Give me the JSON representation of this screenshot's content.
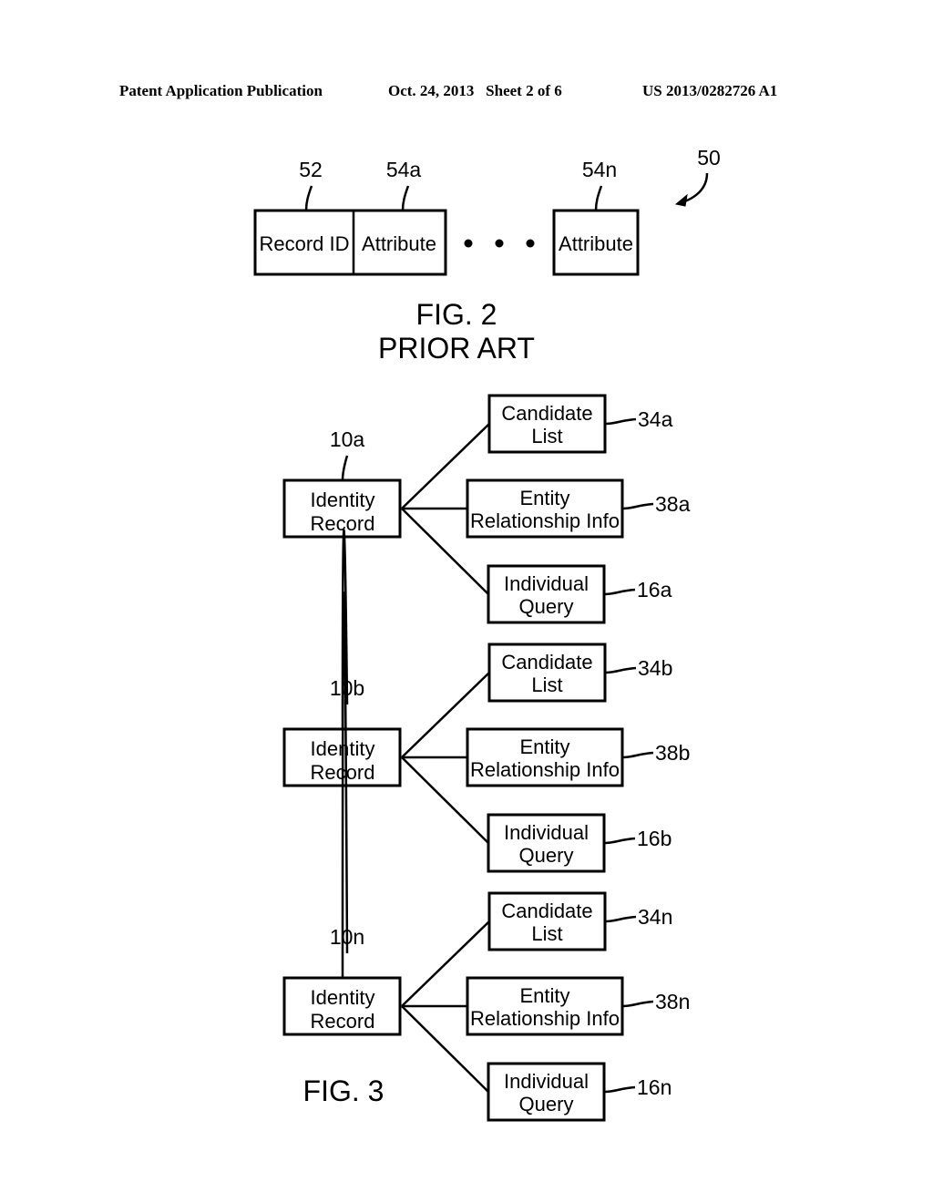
{
  "header": {
    "left": "Patent Application Publication",
    "middle": "Oct. 24, 2013   Sheet 2 of 6",
    "right": "US 2013/0282726 A1"
  },
  "fig2": {
    "ref": "50",
    "cells": [
      {
        "ref": "52",
        "label": "Record ID"
      },
      {
        "ref": "54a",
        "label": "Attribute"
      },
      {
        "ref": "54n",
        "label": "Attribute"
      }
    ],
    "caption_line1": "FIG. 2",
    "caption_line2": "PRIOR ART"
  },
  "fig3": {
    "caption": "FIG. 3",
    "groups": [
      {
        "root_ref": "10a",
        "root": [
          "Identity",
          "Record"
        ],
        "children": [
          {
            "ref": "34a",
            "lines": [
              "Candidate",
              "List"
            ]
          },
          {
            "ref": "38a",
            "lines": [
              "Entity",
              "Relationship Info"
            ]
          },
          {
            "ref": "16a",
            "lines": [
              "Individual",
              "Query"
            ]
          }
        ]
      },
      {
        "root_ref": "10b",
        "root": [
          "Identity",
          "Record"
        ],
        "children": [
          {
            "ref": "34b",
            "lines": [
              "Candidate",
              "List"
            ]
          },
          {
            "ref": "38b",
            "lines": [
              "Entity",
              "Relationship Info"
            ]
          },
          {
            "ref": "16b",
            "lines": [
              "Individual",
              "Query"
            ]
          }
        ]
      },
      {
        "root_ref": "10n",
        "root": [
          "Identity",
          "Record"
        ],
        "children": [
          {
            "ref": "34n",
            "lines": [
              "Candidate",
              "List"
            ]
          },
          {
            "ref": "38n",
            "lines": [
              "Entity",
              "Relationship Info"
            ]
          },
          {
            "ref": "16n",
            "lines": [
              "Individual",
              "Query"
            ]
          }
        ]
      }
    ]
  }
}
